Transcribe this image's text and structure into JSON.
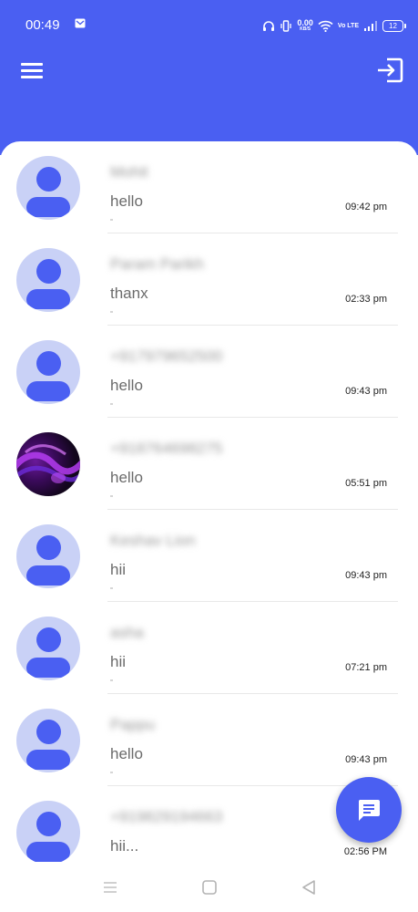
{
  "status_bar": {
    "time": "00:49",
    "net_speed_value": "0.00",
    "net_speed_unit": "KB/S",
    "volte": "Vo LTE",
    "battery": "12"
  },
  "header": {
    "menu_icon": "hamburger-menu-icon",
    "logout_icon": "logout-icon"
  },
  "chats": [
    {
      "name": "Mohit",
      "message": "hello",
      "time": "09:42 pm",
      "avatar": "default"
    },
    {
      "name": "Param Parikh",
      "message": "thanx",
      "time": "02:33 pm",
      "avatar": "default"
    },
    {
      "name": "+917979652500",
      "message": "hello",
      "time": "09:43 pm",
      "avatar": "default"
    },
    {
      "name": "+918764698275",
      "message": "hello",
      "time": "05:51 pm",
      "avatar": "photo"
    },
    {
      "name": "Keshav Lion",
      "message": "hii",
      "time": "09:43 pm",
      "avatar": "default"
    },
    {
      "name": "asha",
      "message": "hii",
      "time": "07:21 pm",
      "avatar": "default"
    },
    {
      "name": "Pappu",
      "message": "hello",
      "time": "09:43 pm",
      "avatar": "default"
    },
    {
      "name": "+919829194663",
      "message": "hii...",
      "time": "02:56 PM",
      "avatar": "default"
    }
  ],
  "fab": {
    "icon": "new-message-icon"
  },
  "navbar": {
    "icons": [
      "recent-apps-icon",
      "home-icon",
      "back-icon"
    ]
  },
  "colors": {
    "accent": "#4a5ff2",
    "avatar_bg": "#c9d1f6"
  }
}
